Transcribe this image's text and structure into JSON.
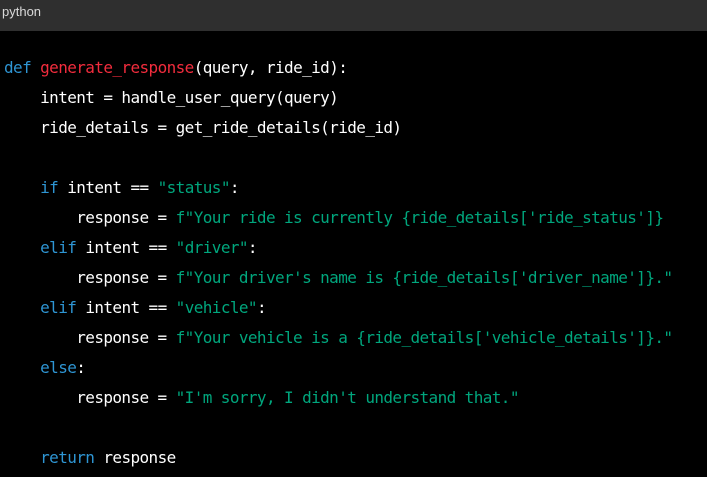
{
  "header": {
    "language": "python"
  },
  "code": {
    "lines": [
      [
        {
          "t": "def ",
          "c": "kw"
        },
        {
          "t": "generate_response",
          "c": "fn"
        },
        {
          "t": "(query, ride_id):",
          "c": "txt"
        }
      ],
      [
        {
          "t": "    intent = handle_user_query(query)",
          "c": "txt"
        }
      ],
      [
        {
          "t": "    ride_details = get_ride_details(ride_id)",
          "c": "txt"
        }
      ],
      [],
      [
        {
          "t": "    ",
          "c": "txt"
        },
        {
          "t": "if",
          "c": "kw"
        },
        {
          "t": " intent == ",
          "c": "txt"
        },
        {
          "t": "\"status\"",
          "c": "str"
        },
        {
          "t": ":",
          "c": "txt"
        }
      ],
      [
        {
          "t": "        response = ",
          "c": "txt"
        },
        {
          "t": "f\"Your ride is currently {ride_details['ride_status']}",
          "c": "str"
        }
      ],
      [
        {
          "t": "    ",
          "c": "txt"
        },
        {
          "t": "elif",
          "c": "kw"
        },
        {
          "t": " intent == ",
          "c": "txt"
        },
        {
          "t": "\"driver\"",
          "c": "str"
        },
        {
          "t": ":",
          "c": "txt"
        }
      ],
      [
        {
          "t": "        response = ",
          "c": "txt"
        },
        {
          "t": "f\"Your driver's name is {ride_details['driver_name']}.\"",
          "c": "str"
        }
      ],
      [
        {
          "t": "    ",
          "c": "txt"
        },
        {
          "t": "elif",
          "c": "kw"
        },
        {
          "t": " intent == ",
          "c": "txt"
        },
        {
          "t": "\"vehicle\"",
          "c": "str"
        },
        {
          "t": ":",
          "c": "txt"
        }
      ],
      [
        {
          "t": "        response = ",
          "c": "txt"
        },
        {
          "t": "f\"Your vehicle is a {ride_details['vehicle_details']}.\"",
          "c": "str"
        }
      ],
      [
        {
          "t": "    ",
          "c": "txt"
        },
        {
          "t": "else",
          "c": "kw"
        },
        {
          "t": ":",
          "c": "txt"
        }
      ],
      [
        {
          "t": "        response = ",
          "c": "txt"
        },
        {
          "t": "\"I'm sorry, I didn't understand that.\"",
          "c": "str"
        }
      ],
      [],
      [
        {
          "t": "    ",
          "c": "txt"
        },
        {
          "t": "return",
          "c": "kw"
        },
        {
          "t": " response",
          "c": "txt"
        }
      ]
    ]
  },
  "colors": {
    "background": "#000000",
    "header": "#2f2f2f",
    "keyword": "#2e95d3",
    "function_name": "#f22c3d",
    "string": "#00a67d",
    "text": "#ffffff"
  }
}
